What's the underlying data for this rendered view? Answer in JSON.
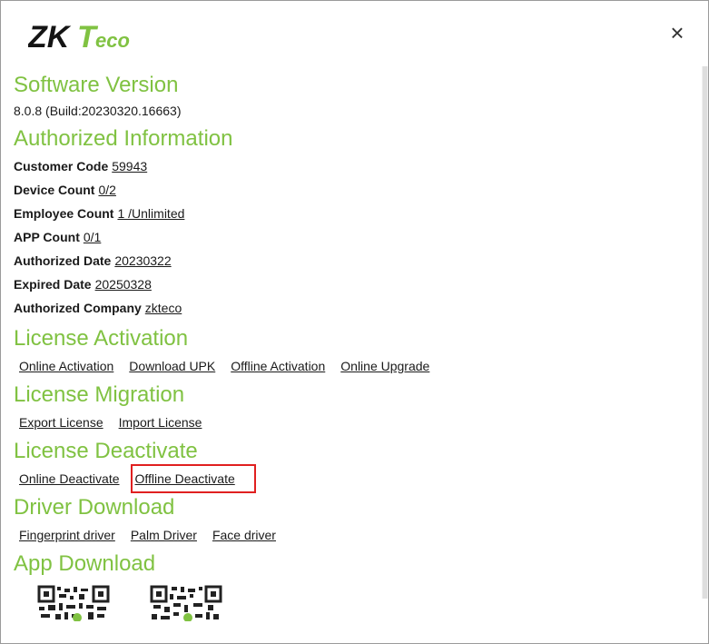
{
  "header": {
    "logo_text": "ZKTeco",
    "close_label": "×"
  },
  "software_version": {
    "title": "Software Version",
    "value": "8.0.8 (Build:20230320.16663)"
  },
  "authorized_info": {
    "title": "Authorized Information",
    "rows": [
      {
        "label": "Customer Code",
        "value": "59943"
      },
      {
        "label": "Device Count",
        "value": "0/2"
      },
      {
        "label": "Employee Count",
        "value": "1 /Unlimited"
      },
      {
        "label": "APP Count",
        "value": "0/1"
      },
      {
        "label": "Authorized Date",
        "value": "20230322"
      },
      {
        "label": "Expired Date",
        "value": "20250328"
      },
      {
        "label": "Authorized Company",
        "value": "zkteco"
      }
    ]
  },
  "license_activation": {
    "title": "License Activation",
    "links": [
      "Online Activation",
      "Download UPK",
      "Offline Activation",
      "Online Upgrade"
    ]
  },
  "license_migration": {
    "title": "License Migration",
    "links": [
      "Export License",
      "Import License"
    ]
  },
  "license_deactivate": {
    "title": "License Deactivate",
    "links": [
      "Online Deactivate",
      "Offline Deactivate"
    ],
    "highlighted": "Offline Deactivate"
  },
  "driver_download": {
    "title": "Driver Download",
    "links": [
      "Fingerprint driver",
      "Palm Driver",
      "Face driver"
    ]
  },
  "app_download": {
    "title": "App Download"
  },
  "colors": {
    "accent_green": "#80c242",
    "logo_dark": "#141414",
    "highlight_red": "#e02020"
  }
}
